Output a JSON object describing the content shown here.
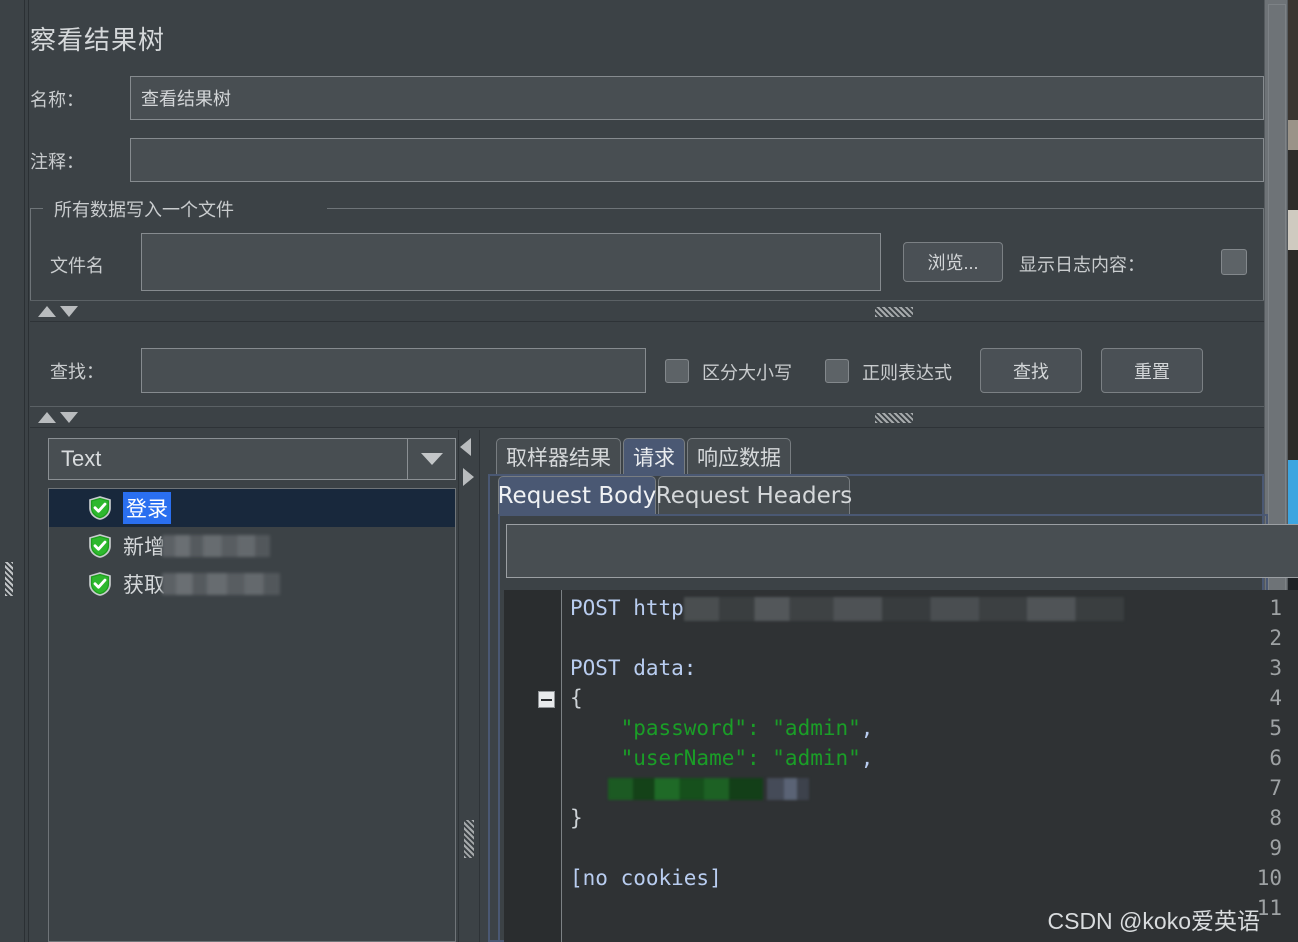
{
  "window": {
    "title": "察看结果树",
    "watermark": "CSDN @koko爱英语"
  },
  "form": {
    "name_label": "名称：",
    "name_value": "查看结果树",
    "comment_label": "注释：",
    "comment_value": ""
  },
  "file_group": {
    "legend": "所有数据写入一个文件",
    "filename_label": "文件名",
    "filename_value": "",
    "browse_label": "浏览...",
    "show_log_label": "显示日志内容：",
    "show_log_checked": false
  },
  "search": {
    "find_label": "查找：",
    "find_value": "",
    "case_sensitive_label": "区分大小写",
    "case_sensitive_checked": false,
    "regex_label": "正则表达式",
    "regex_checked": false,
    "find_button": "查找",
    "reset_button": "重置"
  },
  "renderer": {
    "selected": "Text"
  },
  "tree": {
    "items": [
      {
        "label": "登录",
        "redacted": "",
        "status": "success",
        "selected": true
      },
      {
        "label": "新增",
        "redacted": "REDACTED",
        "status": "success",
        "selected": false
      },
      {
        "label": "获取",
        "redacted": "REDACTED",
        "status": "success",
        "selected": false
      }
    ]
  },
  "tabs": {
    "items": [
      {
        "label": "取样器结果",
        "active": false
      },
      {
        "label": "请求",
        "active": true
      },
      {
        "label": "响应数据",
        "active": false
      }
    ]
  },
  "subtabs": {
    "items": [
      {
        "label": "Request Body",
        "active": true
      },
      {
        "label": "Request Headers",
        "active": false
      }
    ]
  },
  "request_search": {
    "value": "",
    "placeholder": ""
  },
  "code": {
    "lines": [
      {
        "n": "1",
        "fold": false,
        "segments": [
          {
            "t": "POST http",
            "c": "kw"
          },
          {
            "t": "REDACTED-URL",
            "c": "blur"
          }
        ]
      },
      {
        "n": "2",
        "fold": false,
        "segments": []
      },
      {
        "n": "3",
        "fold": false,
        "segments": [
          {
            "t": "POST data:",
            "c": "kw"
          }
        ]
      },
      {
        "n": "4",
        "fold": true,
        "segments": [
          {
            "t": "{",
            "c": "pun"
          }
        ]
      },
      {
        "n": "5",
        "fold": false,
        "segments": [
          {
            "t": "    \"password\": \"admin\"",
            "c": "str"
          },
          {
            "t": ",",
            "c": "kw"
          }
        ]
      },
      {
        "n": "6",
        "fold": false,
        "segments": [
          {
            "t": "    \"userName\": \"admin\"",
            "c": "str"
          },
          {
            "t": ",",
            "c": "kw"
          }
        ]
      },
      {
        "n": "7",
        "fold": false,
        "segments": [
          {
            "t": "REDACTED-KEY",
            "c": "blur-green"
          },
          {
            "t": "REDACTED-VAL",
            "c": "blur-blue"
          }
        ]
      },
      {
        "n": "8",
        "fold": false,
        "segments": [
          {
            "t": "}",
            "c": "pun"
          }
        ]
      },
      {
        "n": "9",
        "fold": false,
        "segments": []
      },
      {
        "n": "10",
        "fold": false,
        "segments": [
          {
            "t": "[no cookies]",
            "c": "kw"
          }
        ]
      },
      {
        "n": "11",
        "fold": false,
        "segments": []
      }
    ]
  },
  "colors": {
    "background": "#3c4246",
    "field_bg": "#484e52",
    "accent_tab": "#4a5873",
    "selection_blue": "#2a6ff0",
    "selection_row": "#18283c",
    "string_green": "#1a9e27",
    "keyword_blue": "#b9cdf0",
    "code_bg": "#2f3234",
    "success_shield": "#2aa02a"
  }
}
